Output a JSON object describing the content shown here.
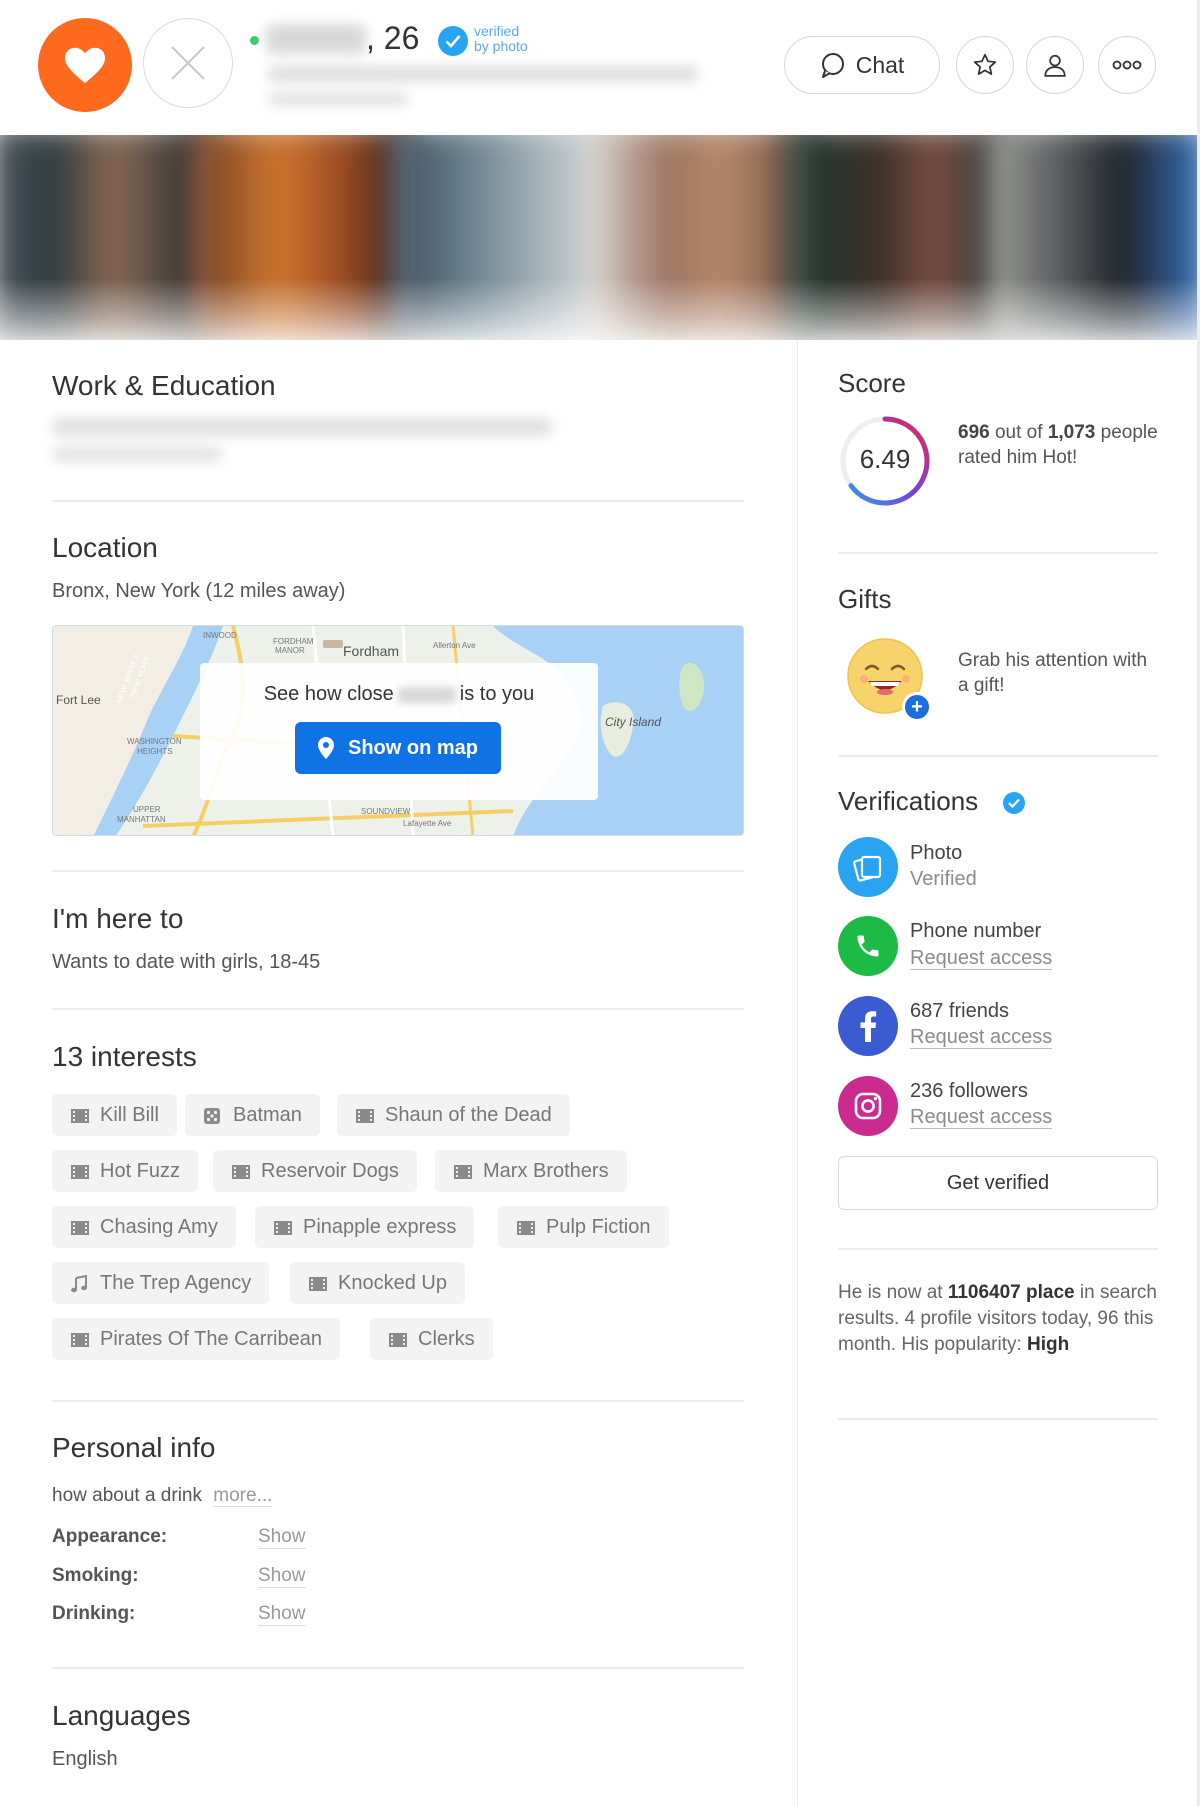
{
  "header": {
    "age": ", 26",
    "verified_line1": "verified",
    "verified_line2": "by photo",
    "chat_label": "Chat"
  },
  "colors": {
    "like": "#fe6a1e",
    "primary_button": "#0f72e5",
    "verified": "#29a4f0",
    "online": "#3dc870"
  },
  "sections": {
    "work": {
      "title": "Work & Education"
    },
    "location": {
      "title": "Location",
      "text": "Bronx, New York (12 miles away)",
      "map_prompt_before": "See how close",
      "map_prompt_after": "is to you",
      "map_button": "Show on map",
      "map_labels": [
        "Fordham",
        "FORDHAM MANOR",
        "INWOOD",
        "Fort Lee",
        "WASHINGTON HEIGHTS",
        "NEW JERSEY",
        "NEW YORK",
        "City Island",
        "UPPER MANHATTAN",
        "SOUNDVIEW",
        "Lafayette Ave",
        "Allerton Ave"
      ]
    },
    "here_to": {
      "title": "I'm here to",
      "text": "Wants to date with girls, 18-45"
    },
    "interests": {
      "title": "13 interests",
      "items": [
        {
          "label": "Kill Bill",
          "icon": "film-icon"
        },
        {
          "label": "Batman",
          "icon": "dice-icon"
        },
        {
          "label": "Shaun of the Dead",
          "icon": "film-icon"
        },
        {
          "label": "Hot Fuzz",
          "icon": "film-icon"
        },
        {
          "label": "Reservoir Dogs",
          "icon": "film-icon"
        },
        {
          "label": "Marx Brothers",
          "icon": "film-icon"
        },
        {
          "label": "Chasing Amy",
          "icon": "film-icon"
        },
        {
          "label": "Pinapple express",
          "icon": "film-icon"
        },
        {
          "label": "Pulp Fiction",
          "icon": "film-icon"
        },
        {
          "label": "The Trep Agency",
          "icon": "music-note-icon"
        },
        {
          "label": "Knocked Up",
          "icon": "film-icon"
        },
        {
          "label": "Pirates Of The Carribean",
          "icon": "film-icon"
        },
        {
          "label": "Clerks",
          "icon": "film-icon"
        }
      ]
    },
    "personal": {
      "title": "Personal info",
      "text": "how about a drink",
      "more": "more...",
      "rows": [
        {
          "label": "Appearance:",
          "value": "Show"
        },
        {
          "label": "Smoking:",
          "value": "Show"
        },
        {
          "label": "Drinking:",
          "value": "Show"
        }
      ]
    },
    "languages": {
      "title": "Languages",
      "text": "English"
    }
  },
  "score": {
    "title": "Score",
    "value": "6.49",
    "fill_fraction": 0.649,
    "rated_count": "696",
    "out_of": "out of",
    "total": "1,073",
    "rest": "people rated him Hot!"
  },
  "gifts": {
    "title": "Gifts",
    "text": "Grab his attention with a gift!",
    "plus": "+"
  },
  "verifications": {
    "title": "Verifications",
    "items": [
      {
        "title": "Photo",
        "sub": "Verified",
        "icon": "photo-icon",
        "color": "#29a4f0"
      },
      {
        "title": "Phone number",
        "sub": "Request access",
        "icon": "phone-icon",
        "color": "#1dbb45"
      },
      {
        "title": "687 friends",
        "sub": "Request access",
        "icon": "facebook-icon",
        "color": "#3b5bd0"
      },
      {
        "title": "236 followers",
        "sub": "Request access",
        "icon": "instagram-icon",
        "color": "#cb2a8e"
      }
    ],
    "button": "Get verified"
  },
  "stats": {
    "p1": "He is now at",
    "place": "1106407 place",
    "p2": "in search results. 4 profile visitors today, 96 this month. His popularity:",
    "popularity": "High"
  }
}
